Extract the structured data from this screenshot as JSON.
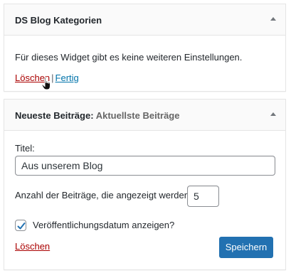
{
  "widget1": {
    "title": "DS Blog Kategorien",
    "description": "Für dieses Widget gibt es keine weiteren Einstellungen.",
    "delete_label": "Löschen",
    "separator": "|",
    "done_label": "Fertig"
  },
  "widget2": {
    "title": "Neueste Beiträge",
    "title_separator": ":",
    "in_title": "Aktuellste Beiträge",
    "title_label": "Titel:",
    "title_value": "Aus unserem Blog",
    "count_label": "Anzahl der Beiträge, die angezeigt werden:",
    "count_value": "5",
    "show_date_label": "Veröffentlichungsdatum anzeigen?",
    "show_date_checked": true,
    "delete_label": "Löschen",
    "save_label": "Speichern"
  },
  "colors": {
    "delete_link": "#aa0000",
    "done_link": "#0073aa",
    "save_button": "#2271b1",
    "check_mark": "#2271b1"
  },
  "icons": {
    "toggle": "arrow-up-icon",
    "checkmark": "checkmark-icon",
    "cursor": "hand-pointer-cursor-icon"
  }
}
